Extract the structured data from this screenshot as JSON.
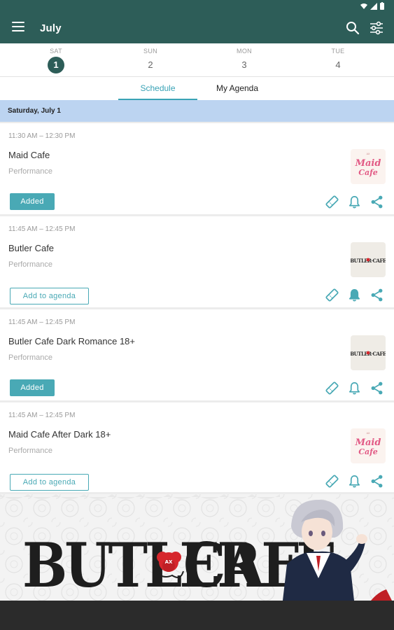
{
  "header": {
    "title": "July"
  },
  "days": [
    {
      "name": "SAT",
      "num": "1"
    },
    {
      "name": "SUN",
      "num": "2"
    },
    {
      "name": "MON",
      "num": "3"
    },
    {
      "name": "TUE",
      "num": "4"
    }
  ],
  "active_day_index": 0,
  "tabs": [
    {
      "label": "Schedule",
      "active": true
    },
    {
      "label": "My Agenda",
      "active": false
    }
  ],
  "date_header": "Saturday, July 1",
  "events": [
    {
      "time": "11:30 AM – 12:30 PM",
      "title": "Maid Cafe",
      "category": "Performance",
      "agenda_state": "Added",
      "thumb": "maid-cafe-logo",
      "reminder_on": false
    },
    {
      "time": "11:45 AM – 12:45 PM",
      "title": "Butler Cafe",
      "category": "Performance",
      "agenda_state": "Add to agenda",
      "thumb": "butler-cafe-logo",
      "reminder_on": true
    },
    {
      "time": "11:45 AM – 12:45 PM",
      "title": "Butler Cafe Dark Romance 18+",
      "category": "Performance",
      "agenda_state": "Added",
      "thumb": "butler-cafe-logo",
      "reminder_on": false
    },
    {
      "time": "11:45 AM – 12:45 PM",
      "title": "Maid Cafe After Dark 18+",
      "category": "Performance",
      "agenda_state": "Add to agenda",
      "thumb": "maid-cafe-logo",
      "reminder_on": false
    }
  ],
  "logos": {
    "maid": "Maid Cafe",
    "butler": "BUTLER CAFE",
    "ax_badge": "AX"
  },
  "banner": {
    "word_left": "BUTLER",
    "word_right": "CAFE",
    "badge": "AX"
  },
  "colors": {
    "primary": "#2d5d58",
    "accent": "#49a9b5",
    "date_header_bg": "#bcd4f1",
    "maid_pink": "#e25a85",
    "rose_red": "#d6262c"
  }
}
